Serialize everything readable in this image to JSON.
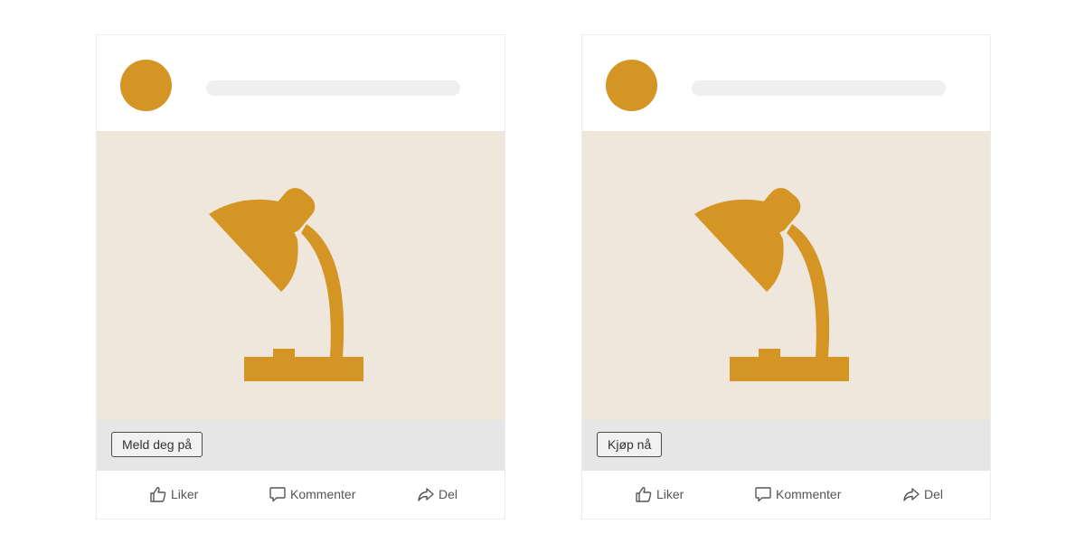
{
  "posts": [
    {
      "cta_label": "Meld deg på",
      "actions": {
        "like": "Liker",
        "comment": "Kommenter",
        "share": "Del"
      },
      "image_icon": "desk-lamp-icon"
    },
    {
      "cta_label": "Kjøp nå",
      "actions": {
        "like": "Liker",
        "comment": "Kommenter",
        "share": "Del"
      },
      "image_icon": "desk-lamp-icon"
    }
  ],
  "colors": {
    "accent": "#d49525",
    "image_background": "#efe6dc",
    "placeholder_bar": "#efefef",
    "cta_strip": "#e6e6e6",
    "text": "#555555"
  }
}
